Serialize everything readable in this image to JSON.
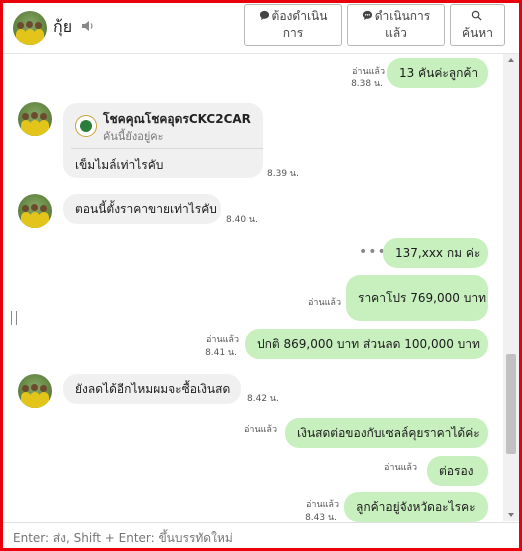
{
  "header": {
    "contact_name": "กุ้ย",
    "buttons": {
      "pending": "ต้องดำเนินการ",
      "in_progress": "ดำเนินการแล้ว",
      "search": "ค้นหา"
    }
  },
  "messages": [
    {
      "side": "me",
      "text": "13 คันค่ะลูกค้า",
      "status": "อ่านแล้ว",
      "time": "8.38 น."
    },
    {
      "side": "them",
      "type": "reply-card",
      "card_title": "โชคคุณโชคอุดรCKC2CAR",
      "card_sub": "คันนี้ยังอยู่คะ",
      "text": "เข็มไมล์เท่าไรคับ",
      "time": "8.39 น."
    },
    {
      "side": "them",
      "text": "ตอนนี้ตั้งราคาขายเท่าไรคับ",
      "time": "8.40 น."
    },
    {
      "side": "me",
      "text": "137,xxx  กม ค่ะ",
      "menu": "•••"
    },
    {
      "side": "me",
      "text": "ราคาโปร 769,000 บาท",
      "status": "อ่านแล้ว"
    },
    {
      "side": "me",
      "text": "ปกติ 869,000 บาท  ส่วนลด 100,000  บาท",
      "status": "อ่านแล้ว",
      "time": "8.41 น."
    },
    {
      "side": "them",
      "text": "ยังลดได้อีกไหมผมจะซื้อเงินสด",
      "time": "8.42 น."
    },
    {
      "side": "me",
      "text": "เงินสดต่อของกับเซลล์คุยราคาได้ค่ะ",
      "status": "อ่านแล้ว"
    },
    {
      "side": "me",
      "text": "ต่อรอง",
      "status": "อ่านแล้ว"
    },
    {
      "side": "me",
      "text": "ลูกค้าอยู่จังหวัดอะไรคะ",
      "status": "อ่านแล้ว",
      "time": "8.43 น."
    }
  ],
  "composer": {
    "placeholder": "Enter: ส่ง, Shift + Enter: ขึ้นบรรทัดใหม่"
  },
  "colors": {
    "frame": "#e8000b",
    "my_bubble": "#c8f0bf",
    "their_bubble": "#f0f0f0"
  }
}
